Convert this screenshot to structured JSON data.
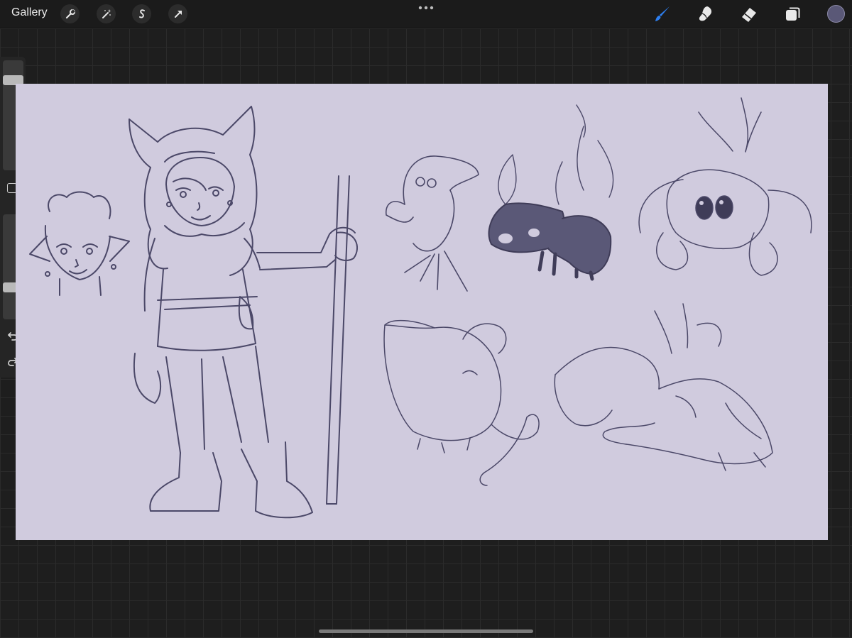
{
  "topbar": {
    "gallery_label": "Gallery",
    "left_tools": [
      "wrench-icon",
      "magic-wand-icon",
      "selection-s-icon",
      "transform-arrow-icon"
    ],
    "right_tools": [
      "brush-icon",
      "smudge-icon",
      "eraser-icon",
      "layers-icon"
    ],
    "active_tool": "brush-icon",
    "accent_color": "#2d7ff0",
    "current_color": "#5a5877"
  },
  "sidebar": {
    "brush_size_level": 0.15,
    "opacity_level": 0.72,
    "buttons": [
      "modifier-square-icon",
      "undo-icon",
      "redo-icon"
    ]
  },
  "canvas": {
    "background_color": "#d0cbde",
    "ink_color": "#4b4868"
  }
}
